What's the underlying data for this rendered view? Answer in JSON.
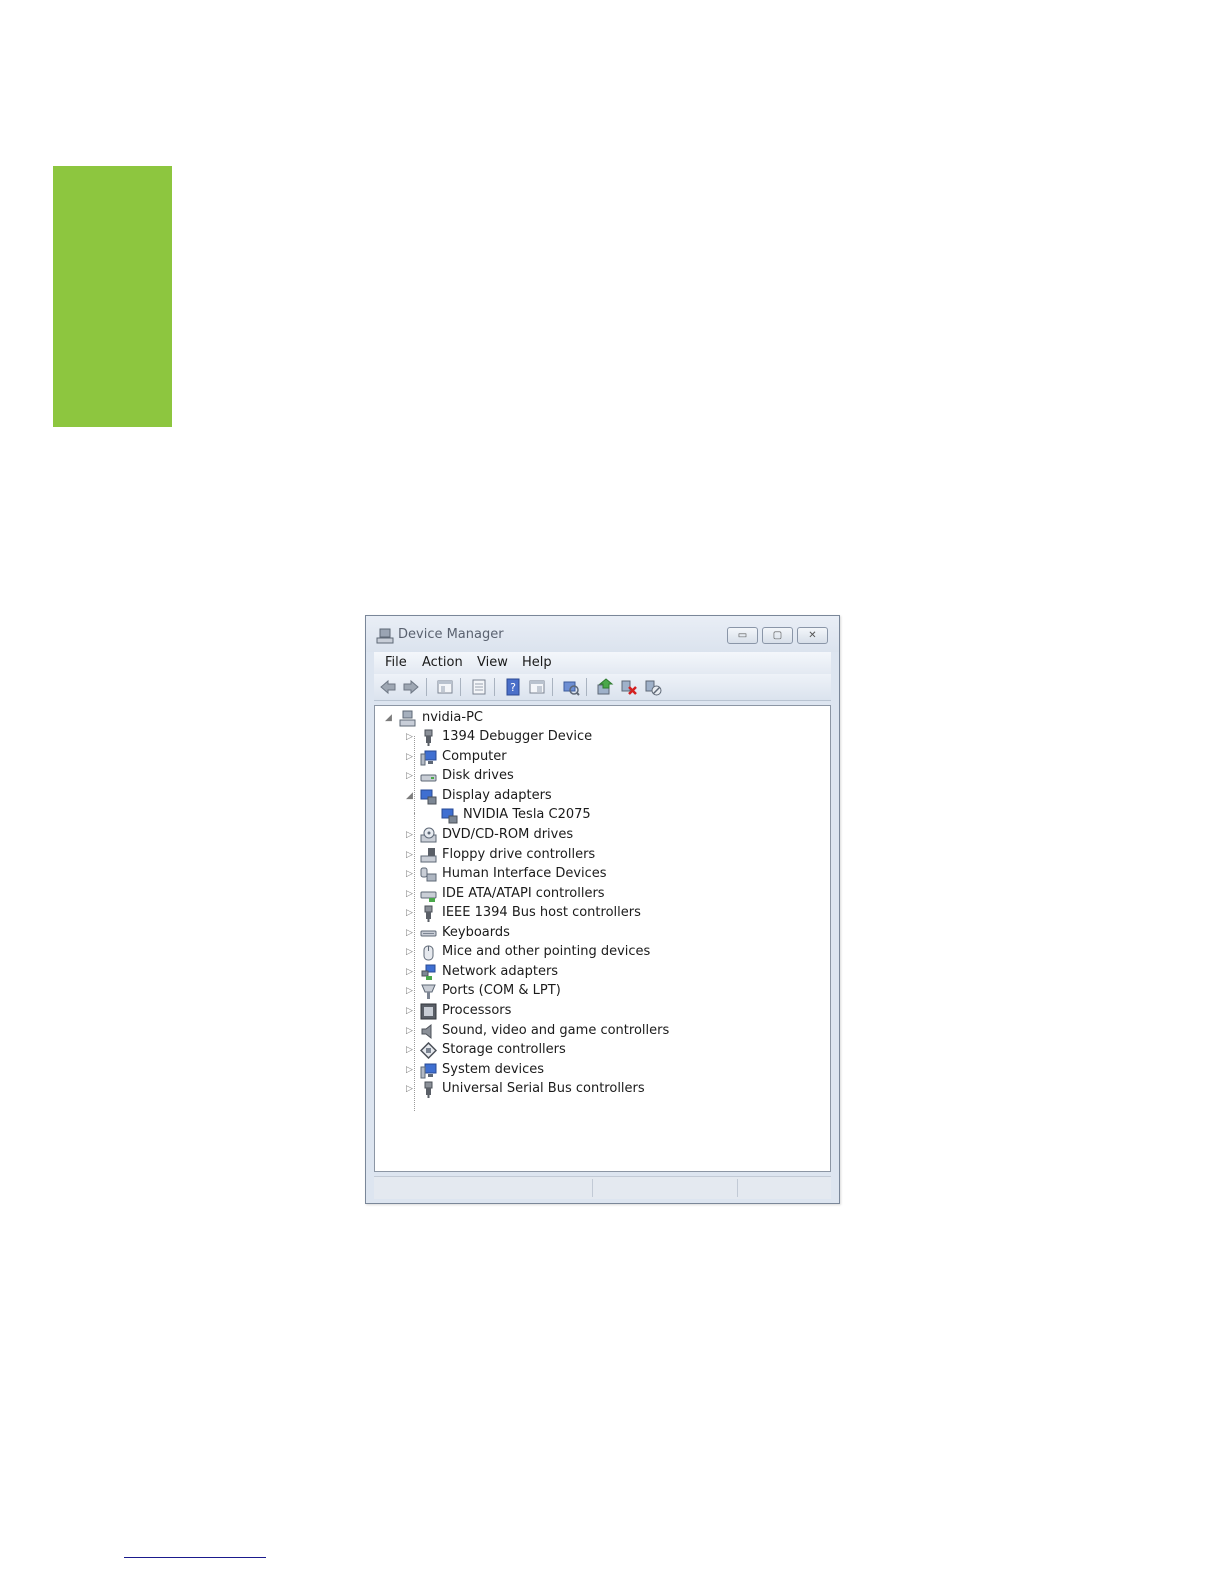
{
  "window": {
    "title": "Device Manager",
    "controls": {
      "minimize": "▭",
      "maximize": "▢",
      "close": "✕"
    }
  },
  "menu": [
    "File",
    "Action",
    "View",
    "Help"
  ],
  "toolbar": [
    "back-icon",
    "forward-icon",
    "show-hide-console-tree-icon",
    "properties-icon",
    "help-icon",
    "view-icon",
    "scan-hardware-icon",
    "update-driver-icon",
    "uninstall-icon",
    "disable-icon"
  ],
  "tree": {
    "root": "nvidia-PC",
    "categories": [
      {
        "label": "1394 Debugger Device",
        "icon": "usb-plug-icon",
        "expanded": false
      },
      {
        "label": "Computer",
        "icon": "computer-icon",
        "expanded": false
      },
      {
        "label": "Disk drives",
        "icon": "disk-drive-icon",
        "expanded": false
      },
      {
        "label": "Display adapters",
        "icon": "display-adapter-icon",
        "expanded": true,
        "children": [
          "NVIDIA Tesla C2075"
        ]
      },
      {
        "label": "DVD/CD-ROM drives",
        "icon": "dvd-drive-icon",
        "expanded": false
      },
      {
        "label": "Floppy drive controllers",
        "icon": "floppy-icon",
        "expanded": false
      },
      {
        "label": "Human Interface Devices",
        "icon": "hid-icon",
        "expanded": false
      },
      {
        "label": "IDE ATA/ATAPI controllers",
        "icon": "ide-icon",
        "expanded": false
      },
      {
        "label": "IEEE 1394 Bus host controllers",
        "icon": "usb-plug-icon",
        "expanded": false
      },
      {
        "label": "Keyboards",
        "icon": "keyboard-icon",
        "expanded": false
      },
      {
        "label": "Mice and other pointing devices",
        "icon": "mouse-icon",
        "expanded": false
      },
      {
        "label": "Network adapters",
        "icon": "network-icon",
        "expanded": false
      },
      {
        "label": "Ports (COM & LPT)",
        "icon": "port-icon",
        "expanded": false
      },
      {
        "label": "Processors",
        "icon": "processor-icon",
        "expanded": false
      },
      {
        "label": "Sound, video and game controllers",
        "icon": "speaker-icon",
        "expanded": false
      },
      {
        "label": "Storage controllers",
        "icon": "storage-icon",
        "expanded": false
      },
      {
        "label": "System devices",
        "icon": "computer-icon",
        "expanded": false
      },
      {
        "label": "Universal Serial Bus controllers",
        "icon": "usb-plug-icon",
        "expanded": false
      }
    ]
  },
  "colors": {
    "accent_tab": "#8dc63f",
    "footnote_rule": "#1a1a8c"
  }
}
